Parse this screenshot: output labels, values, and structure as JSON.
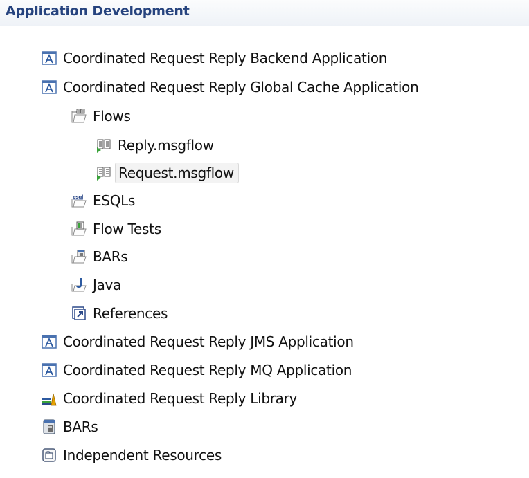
{
  "header": {
    "title": "Application Development"
  },
  "tree": {
    "backend_app": {
      "label": "Coordinated Request Reply Backend Application",
      "icon": "application-icon"
    },
    "global_cache_app": {
      "label": "Coordinated Request Reply Global Cache Application",
      "icon": "application-icon"
    },
    "flows": {
      "label": "Flows",
      "icon": "flows-folder-icon"
    },
    "reply_msgflow": {
      "label": "Reply.msgflow",
      "icon": "msgflow-icon"
    },
    "request_msgflow": {
      "label": "Request.msgflow",
      "icon": "msgflow-icon",
      "selected": true
    },
    "esqls": {
      "label": "ESQLs",
      "icon": "esql-folder-icon"
    },
    "flow_tests": {
      "label": "Flow Tests",
      "icon": "flow-tests-folder-icon"
    },
    "bars_child": {
      "label": "BARs",
      "icon": "bars-folder-icon"
    },
    "java": {
      "label": "Java",
      "icon": "java-folder-icon"
    },
    "references": {
      "label": "References",
      "icon": "references-icon"
    },
    "jms_app": {
      "label": "Coordinated Request Reply JMS Application",
      "icon": "application-icon"
    },
    "mq_app": {
      "label": "Coordinated Request Reply MQ Application",
      "icon": "application-icon"
    },
    "library": {
      "label": "Coordinated Request Reply Library",
      "icon": "library-icon"
    },
    "bars_root": {
      "label": "BARs",
      "icon": "bar-file-icon"
    },
    "independent_resources": {
      "label": "Independent Resources",
      "icon": "independent-resources-icon"
    }
  }
}
